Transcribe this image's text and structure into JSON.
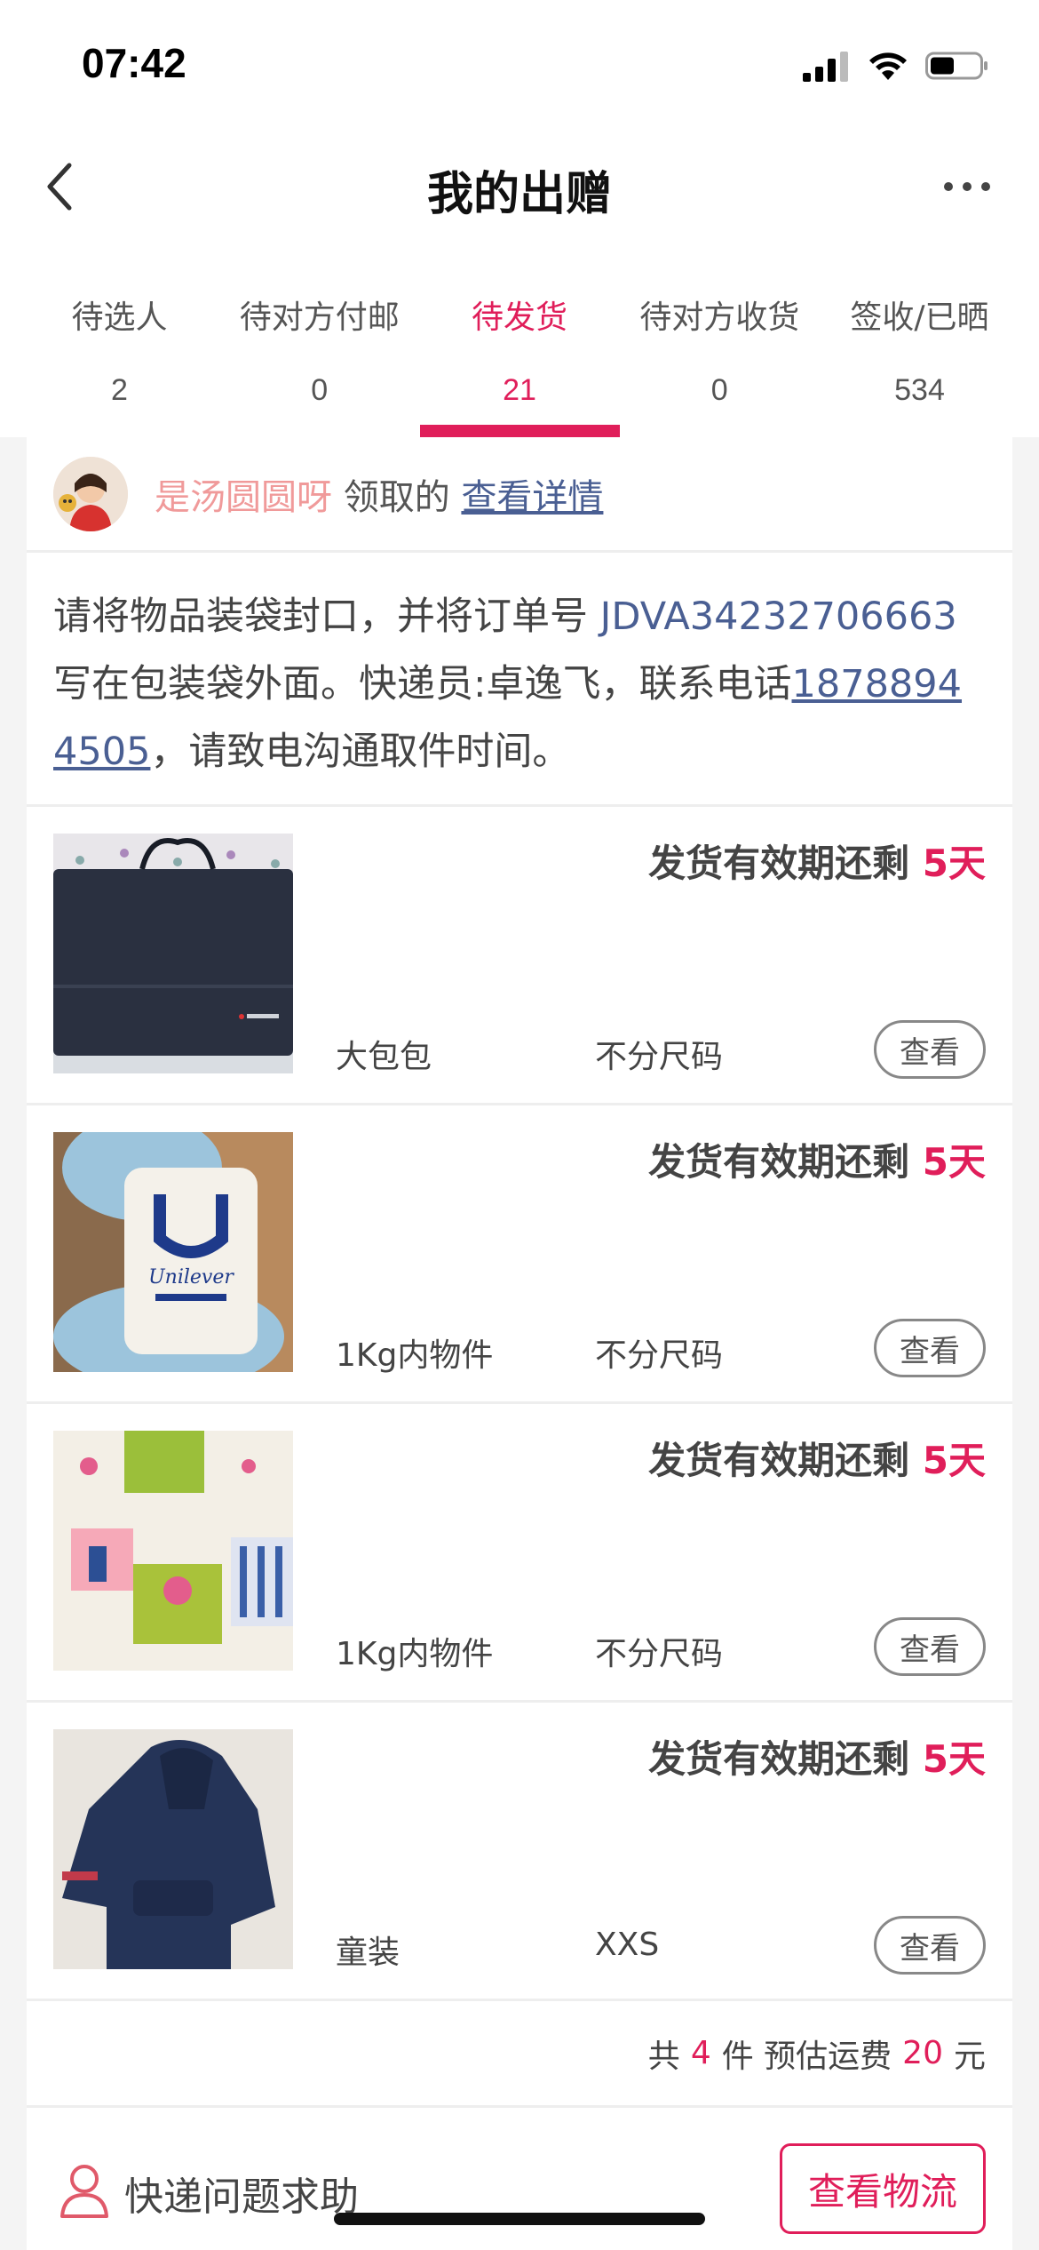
{
  "status_bar": {
    "time": "07:42"
  },
  "nav": {
    "title": "我的出赠"
  },
  "tabs": [
    {
      "label": "待选人",
      "count": "2"
    },
    {
      "label": "待对方付邮",
      "count": "0"
    },
    {
      "label": "待发货",
      "count": "21"
    },
    {
      "label": "待对方收货",
      "count": "0"
    },
    {
      "label": "签收/已晒",
      "count": "534"
    }
  ],
  "active_tab_index": 2,
  "receiver": {
    "name": "是汤圆圆呀",
    "action": " 领取的 ",
    "detail_link": "查看详情"
  },
  "notice": {
    "prefix": "请将物品装袋封口，并将订单号 ",
    "order_no": "JDVA34232706663",
    "middle": " 写在包装袋外面。快递员:卓逸飞，联系电话",
    "phone": "18788944505",
    "suffix": "，请致电沟通取件时间。"
  },
  "items": [
    {
      "deadline_label": "发货有效期还剩 ",
      "days": "5天",
      "name": "大包包",
      "size": "不分尺码",
      "view_label": "查看"
    },
    {
      "deadline_label": "发货有效期还剩 ",
      "days": "5天",
      "name": "1Kg内物件",
      "size": "不分尺码",
      "view_label": "查看"
    },
    {
      "deadline_label": "发货有效期还剩 ",
      "days": "5天",
      "name": "1Kg内物件",
      "size": "不分尺码",
      "view_label": "查看"
    },
    {
      "deadline_label": "发货有效期还剩 ",
      "days": "5天",
      "name": "童装",
      "size": "XXS",
      "view_label": "查看"
    }
  ],
  "summary": {
    "prefix": "共",
    "count": "4",
    "middle": "件 预估运费",
    "fee": "20",
    "suffix": "元"
  },
  "help": {
    "label": "快递问题求助"
  },
  "logistics_button": "查看物流",
  "colors": {
    "accent": "#e01e5a",
    "link": "#4a5f93",
    "receiver_name": "#f09a9a"
  }
}
